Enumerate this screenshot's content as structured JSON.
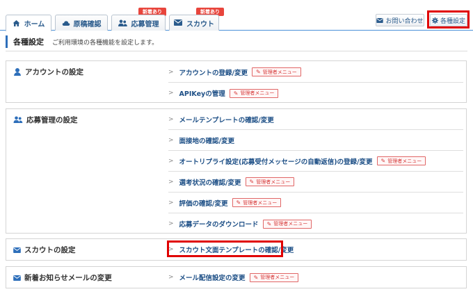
{
  "tabs": [
    {
      "label": "ホーム",
      "icon": "home-icon",
      "badge": ""
    },
    {
      "label": "原稿確認",
      "icon": "cloud-icon",
      "badge": ""
    },
    {
      "label": "応募管理",
      "icon": "users-icon",
      "badge": "新着あり"
    },
    {
      "label": "スカウト",
      "icon": "mail-icon",
      "badge": "新着あり"
    }
  ],
  "header_buttons": {
    "contact": "お問い合わせ",
    "settings": "各種設定"
  },
  "page": {
    "title": "各種設定",
    "description": "ご利用環境の各種機能を設定します。"
  },
  "admin_label": "管理者メニュー",
  "sections": [
    {
      "title": "アカウントの設定",
      "icon": "user-icon",
      "items": [
        {
          "label": "アカウントの登録/変更",
          "admin": true
        },
        {
          "label": "APIKeyの管理",
          "admin": true
        }
      ]
    },
    {
      "title": "応募管理の設定",
      "icon": "users-icon",
      "items": [
        {
          "label": "メールテンプレートの確認/変更",
          "admin": false
        },
        {
          "label": "面接地の確認/変更",
          "admin": false
        },
        {
          "label": "オートリプライ設定(応募受付メッセージの自動返信)の登録/変更",
          "admin": true
        },
        {
          "label": "選考状況の確認/変更",
          "admin": true
        },
        {
          "label": "評価の確認/変更",
          "admin": true
        },
        {
          "label": "応募データのダウンロード",
          "admin": true
        }
      ]
    },
    {
      "title": "スカウトの設定",
      "icon": "mail-icon",
      "items": [
        {
          "label": "スカウト文面テンプレートの確認/変更",
          "admin": false
        }
      ]
    },
    {
      "title": "新着お知らせメールの変更",
      "icon": "mail-icon",
      "items": [
        {
          "label": "メール配信設定の変更",
          "admin": true
        }
      ]
    }
  ]
}
